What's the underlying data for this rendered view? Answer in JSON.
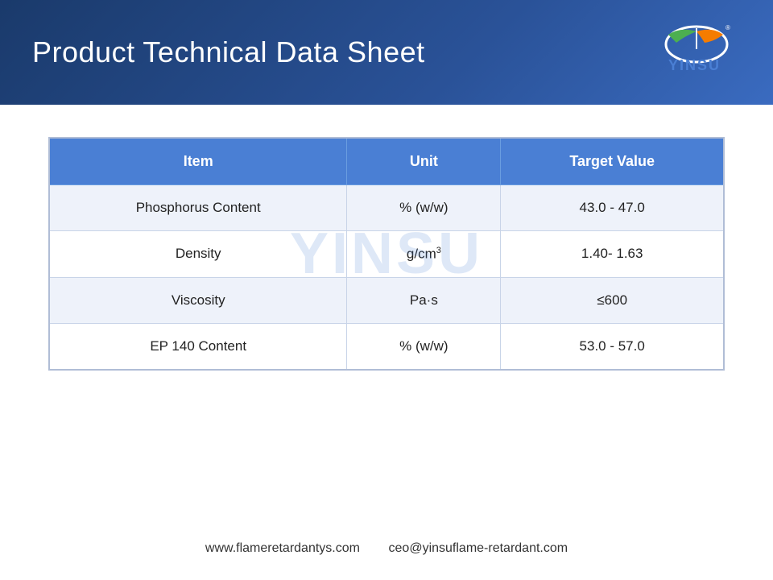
{
  "header": {
    "title": "Product Technical Data Sheet",
    "logo_text": "YINSU"
  },
  "table": {
    "columns": [
      "Item",
      "Unit",
      "Target Value"
    ],
    "rows": [
      {
        "item": "Phosphorus Content",
        "unit": "% (w/w)",
        "value": "43.0 - 47.0"
      },
      {
        "item": "Density",
        "unit": "g/cm³",
        "value": "1.40- 1.63"
      },
      {
        "item": "Viscosity",
        "unit": "Pa·s",
        "value": "≤600"
      },
      {
        "item": "EP 140 Content",
        "unit": "% (w/w)",
        "value": "53.0 - 57.0"
      }
    ]
  },
  "footer": {
    "website": "www.flameretardantys.com",
    "email": "ceo@yinsuflame-retardant.com"
  },
  "watermark": "YINSU"
}
